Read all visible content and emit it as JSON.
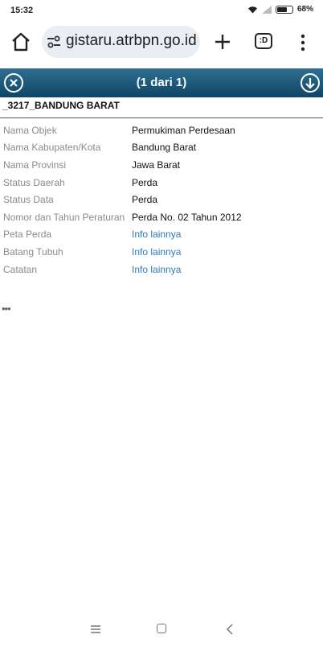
{
  "status_bar": {
    "time": "15:32",
    "battery_pct": "68%",
    "battery_level": 0.68
  },
  "browser": {
    "url": "gistaru.atrbpn.go.id",
    "tabs_label": ":D"
  },
  "popup": {
    "title": "(1 dari 1)",
    "feature_name": "_3217_BANDUNG BARAT",
    "rows": [
      {
        "key": "Nama Objek",
        "value": "Permukiman Perdesaan"
      },
      {
        "key": "Nama Kabupaten/Kota",
        "value": "Bandung Barat"
      },
      {
        "key": "Nama Provinsi",
        "value": "Jawa Barat"
      },
      {
        "key": "Status Daerah",
        "value": "Perda"
      },
      {
        "key": "Status Data",
        "value": "Perda"
      },
      {
        "key": "Nomor dan Tahun Peraturan",
        "value": "Perda No. 02 Tahun 2012"
      },
      {
        "key": "Peta Perda",
        "value": "Info lainnya"
      },
      {
        "key": "Batang Tubuh",
        "value": "Info lainnya"
      },
      {
        "key": "Catatan",
        "value": "Info lainnya"
      }
    ],
    "more": "•••"
  },
  "colors": {
    "header_top": "#2f6f91",
    "header_bottom": "#0f4566",
    "link": "#2b7db7"
  }
}
